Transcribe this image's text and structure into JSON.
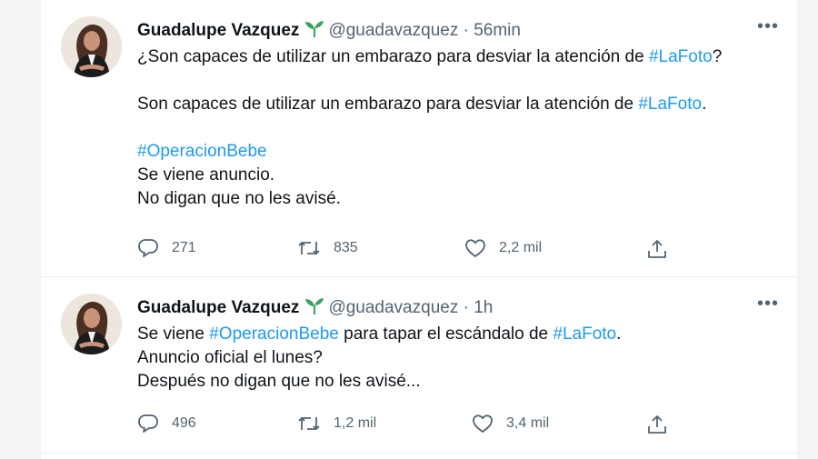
{
  "tweets": [
    {
      "author_name": "Guadalupe Vazquez",
      "handle": "@guadavazquez",
      "time": "56min",
      "lines": [
        [
          "¿Son capaces de utilizar un embarazo para desviar la atención de ",
          "#LaFoto",
          "?"
        ],
        [
          "Son capaces de utilizar un embarazo para desviar la atención de ",
          "#LaFoto",
          "."
        ],
        [
          "#OperacionBebe"
        ],
        [
          "Se viene anuncio."
        ],
        [
          "No digan que no les avisé."
        ]
      ],
      "replies": "271",
      "retweets": "835",
      "likes": "2,2 mil"
    },
    {
      "author_name": "Guadalupe Vazquez",
      "handle": "@guadavazquez",
      "time": "1h",
      "lines": [
        [
          "Se viene ",
          "#OperacionBebe",
          " para tapar el escándalo de ",
          "#LaFoto",
          "."
        ],
        [
          "Anuncio oficial el lunes?"
        ],
        [
          "Después no digan que no les avisé..."
        ]
      ],
      "replies": "496",
      "retweets": "1,2 mil",
      "likes": "3,4 mil"
    }
  ],
  "more_glyph": "•••",
  "separator": "·",
  "icons": {
    "badge": "seedling-icon",
    "reply": "reply-icon",
    "retweet": "retweet-icon",
    "like": "heart-icon",
    "share": "share-icon",
    "more": "more-options-icon"
  },
  "colors": {
    "hashtag": "#1d9bf0",
    "secondary_text": "#536471",
    "badge_green": "#3aa25f"
  }
}
